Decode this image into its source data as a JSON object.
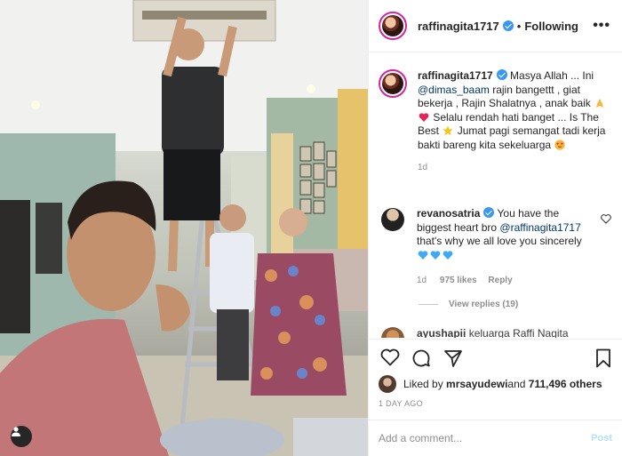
{
  "header": {
    "username": "raffinagita1717",
    "separator": "•",
    "follow_status": "Following",
    "more_label": "•••"
  },
  "caption": {
    "username": "raffinagita1717",
    "text_1": "Masya Allah ... Ini",
    "mention": "@dimas_baam",
    "text_2": " rajin bangettt , giat bekerja , Rajin Shalatnya , anak baik",
    "text_3": " Selalu rendah hati banget ... Is The Best",
    "text_4": " Jumat pagi semangat tadi kerja bakti bareng kita sekeluarga",
    "time": "1d",
    "emojis": [
      "folded-hands",
      "red-heart",
      "star",
      "heart-eyes"
    ]
  },
  "comment": {
    "username": "revanosatria",
    "text_1": "You have the biggest heart bro ",
    "mention": "@raffinagita1717",
    "text_2": " that's why we all love you sincerely",
    "emojis": [
      "blue-heart",
      "blue-heart",
      "blue-heart"
    ],
    "time": "1d",
    "likes": "975 likes",
    "reply_label": "Reply",
    "view_replies": "View replies (19)"
  },
  "next_comment": {
    "username": "ayushapii",
    "text": "keluarga Raffi Nagita"
  },
  "actions": {
    "icons": [
      "heart-icon",
      "comment-icon",
      "share-icon",
      "bookmark-icon"
    ]
  },
  "likes": {
    "prefix": "Liked by ",
    "user": "mrsayudewi",
    "joiner": " and ",
    "count": "711,496 others"
  },
  "date": "1 DAY AGO",
  "add_comment": {
    "placeholder": "Add a comment...",
    "post_label": "Post"
  },
  "colors": {
    "verified": "#3897f0",
    "mention": "#00376b",
    "muted": "#8e8e8e",
    "post_disabled": "#b2dffc",
    "border": "#efefef"
  }
}
